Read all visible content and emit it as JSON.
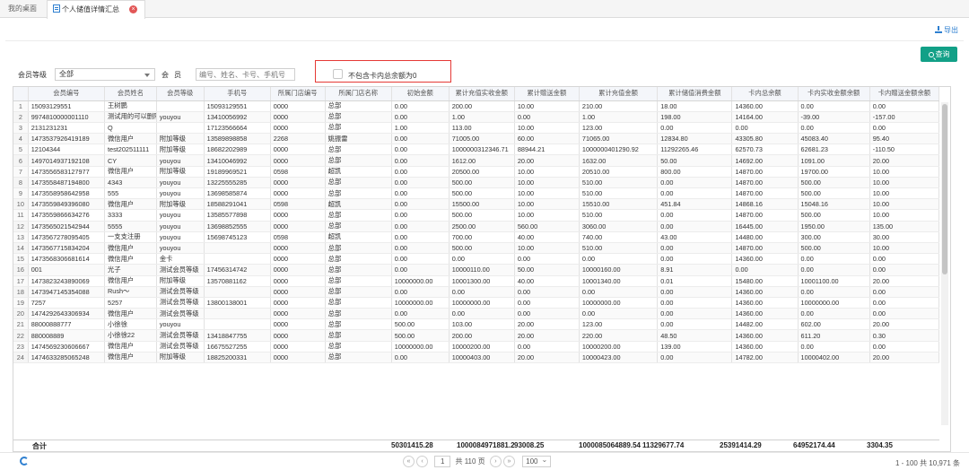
{
  "tabs": {
    "home": "我的桌面",
    "active": "个人储值详情汇总",
    "close_glyph": "×"
  },
  "header": {
    "export_label": "导出",
    "query_label": "查询"
  },
  "filters": {
    "level_label": "会员等级",
    "level_value": "全部",
    "member_label": "会员",
    "member_placeholder": "编号、姓名、卡号、手机号",
    "exclude_zero_label": "不包含卡内总余额为0"
  },
  "table": {
    "columns": [
      "会员编号",
      "会员姓名",
      "会员等级",
      "手机号",
      "所属门店编号",
      "所属门店名称",
      "初始金额",
      "累计充值实收金额",
      "累计赠送金额",
      "累计充值金额",
      "累计储值消费金额",
      "卡内总余额",
      "卡内实收金额余额",
      "卡内赠送金额余额"
    ],
    "rows": [
      [
        "1",
        "15093129551",
        "王树鹏",
        "",
        "15093129551",
        "0000",
        "总部",
        "0.00",
        "200.00",
        "10.00",
        "210.00",
        "18.00",
        "14360.00",
        "0.00",
        "0.00"
      ],
      [
        "2",
        "9974810000001110",
        "测试用的可以删除",
        "youyou",
        "13410056992",
        "0000",
        "总部",
        "0.00",
        "1.00",
        "0.00",
        "1.00",
        "198.00",
        "14164.00",
        "-39.00",
        "-157.00"
      ],
      [
        "3",
        "2131231231",
        "Q",
        "",
        "17123566664",
        "0000",
        "总部",
        "1.00",
        "113.00",
        "10.00",
        "123.00",
        "0.00",
        "0.00",
        "0.00",
        "0.00"
      ],
      [
        "4",
        "1473537926419189",
        "微信用户",
        "附加等级",
        "13589898858",
        "2268",
        "姚振雷",
        "0.00",
        "71005.00",
        "60.00",
        "71065.00",
        "12834.80",
        "43305.80",
        "45083.40",
        "95.40"
      ],
      [
        "5",
        "12104344",
        "test202511111",
        "附加等级",
        "18682202989",
        "0000",
        "总部",
        "0.00",
        "1000000312346.71",
        "88944.21",
        "1000000401290.92",
        "11292265.46",
        "62570.73",
        "62681.23",
        "-110.50"
      ],
      [
        "6",
        "1497014937192108",
        "CY",
        "youyou",
        "13410046992",
        "0000",
        "总部",
        "0.00",
        "1612.00",
        "20.00",
        "1632.00",
        "50.00",
        "14692.00",
        "1091.00",
        "20.00"
      ],
      [
        "7",
        "1473556583127977",
        "微信用户",
        "附加等级",
        "19189969521",
        "0598",
        "超凯",
        "0.00",
        "20500.00",
        "10.00",
        "20510.00",
        "800.00",
        "14870.00",
        "19700.00",
        "10.00"
      ],
      [
        "8",
        "1473558487194800",
        "4343",
        "youyou",
        "13225555285",
        "0000",
        "总部",
        "0.00",
        "500.00",
        "10.00",
        "510.00",
        "0.00",
        "14870.00",
        "500.00",
        "10.00"
      ],
      [
        "9",
        "1473558958642958",
        "555",
        "youyou",
        "13698585874",
        "0000",
        "总部",
        "0.00",
        "500.00",
        "10.00",
        "510.00",
        "0.00",
        "14870.00",
        "500.00",
        "10.00"
      ],
      [
        "10",
        "1473559849396080",
        "微信用户",
        "附加等级",
        "18588291041",
        "0598",
        "超凯",
        "0.00",
        "15500.00",
        "10.00",
        "15510.00",
        "451.84",
        "14868.16",
        "15048.16",
        "10.00"
      ],
      [
        "11",
        "1473559866634276",
        "3333",
        "youyou",
        "13585577898",
        "0000",
        "总部",
        "0.00",
        "500.00",
        "10.00",
        "510.00",
        "0.00",
        "14870.00",
        "500.00",
        "10.00"
      ],
      [
        "12",
        "1473565021542944",
        "5555",
        "youyou",
        "13698852555",
        "0000",
        "总部",
        "0.00",
        "2500.00",
        "560.00",
        "3060.00",
        "0.00",
        "16445.00",
        "1950.00",
        "135.00"
      ],
      [
        "13",
        "1473567278095405",
        "一支支注册",
        "youyou",
        "15698745123",
        "0598",
        "超凯",
        "0.00",
        "700.00",
        "40.00",
        "740.00",
        "43.00",
        "14480.00",
        "300.00",
        "30.00"
      ],
      [
        "14",
        "1473567715834204",
        "微信用户",
        "youyou",
        "",
        "0000",
        "总部",
        "0.00",
        "500.00",
        "10.00",
        "510.00",
        "0.00",
        "14870.00",
        "500.00",
        "10.00"
      ],
      [
        "15",
        "1473568306681614",
        "微信用户",
        "金卡",
        "",
        "0000",
        "总部",
        "0.00",
        "0.00",
        "0.00",
        "0.00",
        "0.00",
        "14360.00",
        "0.00",
        "0.00"
      ],
      [
        "16",
        "001",
        "光子",
        "测试会员等级",
        "17456314742",
        "0000",
        "总部",
        "0.00",
        "10000110.00",
        "50.00",
        "10000160.00",
        "8.91",
        "0.00",
        "0.00",
        "0.00"
      ],
      [
        "17",
        "1473823243890069",
        "微信用户",
        "附加等级",
        "13570881162",
        "0000",
        "总部",
        "10000000.00",
        "10001300.00",
        "40.00",
        "10001340.00",
        "0.01",
        "15480.00",
        "10001100.00",
        "20.00"
      ],
      [
        "18",
        "1473947145354088",
        "Rush～",
        "测试会员等级",
        "",
        "0000",
        "总部",
        "0.00",
        "0.00",
        "0.00",
        "0.00",
        "0.00",
        "14360.00",
        "0.00",
        "0.00"
      ],
      [
        "19",
        "7257",
        "5257",
        "测试会员等级",
        "13800138001",
        "0000",
        "总部",
        "10000000.00",
        "10000000.00",
        "0.00",
        "10000000.00",
        "0.00",
        "14360.00",
        "10000000.00",
        "0.00"
      ],
      [
        "20",
        "1474292643306934",
        "微信用户",
        "测试会员等级",
        "",
        "0000",
        "总部",
        "0.00",
        "0.00",
        "0.00",
        "0.00",
        "0.00",
        "14360.00",
        "0.00",
        "0.00"
      ],
      [
        "21",
        "88000888777",
        "小徐徐",
        "youyou",
        "",
        "0000",
        "总部",
        "500.00",
        "103.00",
        "20.00",
        "123.00",
        "0.00",
        "14482.00",
        "602.00",
        "20.00"
      ],
      [
        "22",
        "880008889",
        "小徐徐22",
        "测试会员等级",
        "13418847755",
        "0000",
        "总部",
        "500.00",
        "200.00",
        "20.00",
        "220.00",
        "48.50",
        "14360.00",
        "611.20",
        "0.30"
      ],
      [
        "23",
        "1474569230606667",
        "微信用户",
        "测试会员等级",
        "16675527255",
        "0000",
        "总部",
        "10000000.00",
        "10000200.00",
        "0.00",
        "10000200.00",
        "139.00",
        "14360.00",
        "0.00",
        "0.00"
      ],
      [
        "24",
        "1474633285065248",
        "微信用户",
        "附加等级",
        "18825200331",
        "0000",
        "总部",
        "0.00",
        "10000403.00",
        "20.00",
        "10000423.00",
        "0.00",
        "14782.00",
        "10000402.00",
        "20.00"
      ]
    ],
    "totals": {
      "label": "合计",
      "initial": "50301415.28",
      "recharge_received": "1000084971881.2",
      "gift": "93008.25",
      "recharge": "1000085064889.54",
      "consume": "11329677.74",
      "balance": "25391414.29",
      "received_balance": "64952174.44",
      "gift_balance": "3304.35"
    }
  },
  "pagination": {
    "first": "«",
    "prev": "‹",
    "page": "1",
    "total_pages": "共 110 页",
    "next": "›",
    "last": "»",
    "page_size": "100",
    "range": "1 - 100 共 10,971 条"
  }
}
